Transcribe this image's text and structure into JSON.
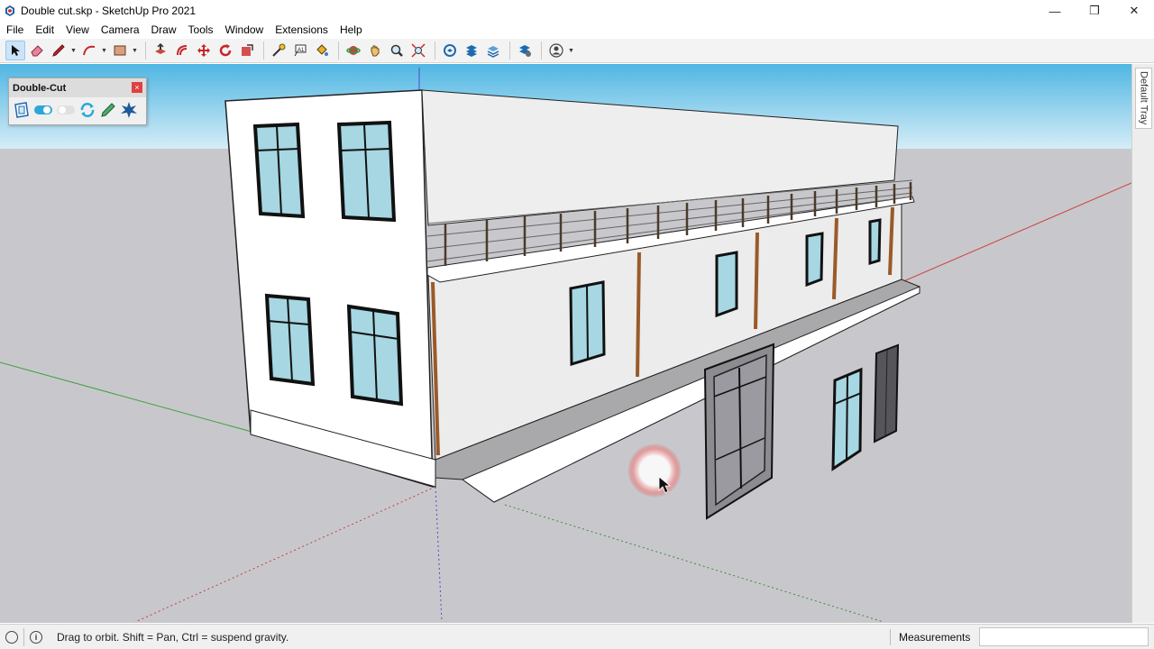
{
  "window": {
    "title": "Double cut.skp - SketchUp Pro 2021",
    "minimize": "—",
    "restore": "❐",
    "close": "✕"
  },
  "menu": [
    "File",
    "Edit",
    "View",
    "Camera",
    "Draw",
    "Tools",
    "Window",
    "Extensions",
    "Help"
  ],
  "toolbar": {
    "tools": [
      "select-tool",
      "eraser-tool",
      "line-tool",
      "arc-tool",
      "shape-tool",
      "push-pull-tool",
      "offset-tool",
      "move-tool",
      "rotate-tool",
      "scale-tool",
      "tape-measure-tool",
      "text-tool",
      "paint-bucket-tool",
      "orbit-tool",
      "pan-tool",
      "zoom-tool",
      "zoom-extents-tool",
      "warehouse-tool",
      "extension-warehouse-tool",
      "layout-tool",
      "extension-manager-tool",
      "account-tool"
    ]
  },
  "double_cut": {
    "title": "Double-Cut",
    "close": "×"
  },
  "tray": {
    "label": "Default Tray"
  },
  "status": {
    "info": "i",
    "hint": "Drag to orbit. Shift = Pan, Ctrl = suspend gravity.",
    "measurements_label": "Measurements",
    "measurements_value": ""
  },
  "colors": {
    "sky": "#5ebde6",
    "ground": "#c8c8cc",
    "red_axis": "#d04040",
    "green_axis": "#3fa03f",
    "blue_axis": "#4a4ad0",
    "wall": "#f2f2f2",
    "window_glass": "#a6d7e2"
  }
}
